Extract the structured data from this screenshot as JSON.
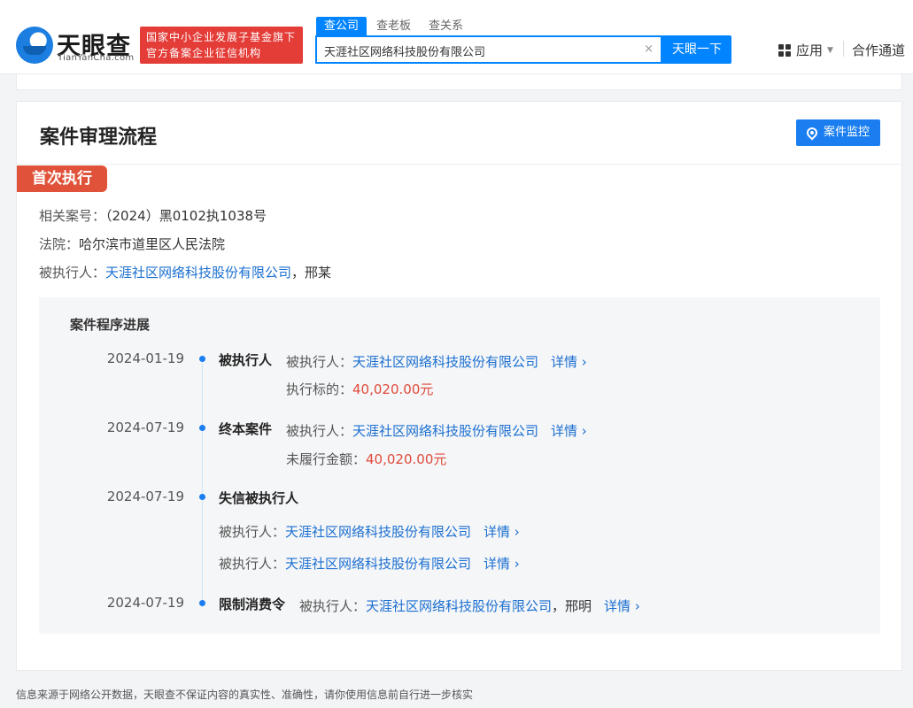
{
  "header": {
    "brand_cn": "天眼查",
    "brand_en": "TianYanCha.com",
    "badge_line1": "国家中小企业发展子基金旗下",
    "badge_line2": "官方备案企业征信机构",
    "search_tabs": [
      "查公司",
      "查老板",
      "查关系"
    ],
    "search_value": "天涯社区网络科技股份有限公司",
    "clear_glyph": "×",
    "search_button": "天眼一下",
    "apps_label": "应用",
    "coop_label": "合作通道"
  },
  "card": {
    "title": "案件审理流程",
    "monitor_button": "案件监控",
    "tag": "首次执行",
    "case_no_label": "相关案号：",
    "case_no": "（2024）黑0102执1038号",
    "court_label": "法院：",
    "court": "哈尔滨市道里区人民法院",
    "executee_label": "被执行人：",
    "executee_company": "天涯社区网络科技股份有限公司",
    "executee_person": "，邢某"
  },
  "timeline": {
    "title": "案件程序进展",
    "entries": [
      {
        "date": "2024-01-19",
        "event": "被执行人",
        "row1_label": "被执行人：",
        "row1_link": "天涯社区网络科技股份有限公司",
        "detail": "详情 ›",
        "row2_label": "执行标的：",
        "row2_amount": "40,020.00元"
      },
      {
        "date": "2024-07-19",
        "event": "终本案件",
        "row1_label": "被执行人：",
        "row1_link": "天涯社区网络科技股份有限公司",
        "detail": "详情 ›",
        "row2_label": "未履行金额：",
        "row2_amount": "40,020.00元"
      },
      {
        "date": "2024-07-19",
        "event": "失信被执行人",
        "row1_label": "被执行人：",
        "row1_link": "天涯社区网络科技股份有限公司",
        "detail": "详情 ›",
        "row2_label": "被执行人：",
        "row2_link": "天涯社区网络科技股份有限公司"
      },
      {
        "date": "2024-07-19",
        "event": "限制消费令",
        "row1_label": "被执行人：",
        "row1_link": "天涯社区网络科技股份有限公司",
        "row1_suffix": "，邢明",
        "detail": "详情 ›"
      }
    ]
  },
  "footer": "信息来源于网络公开数据，天眼查不保证内容的真实性、准确性，请你使用信息前自行进一步核实"
}
